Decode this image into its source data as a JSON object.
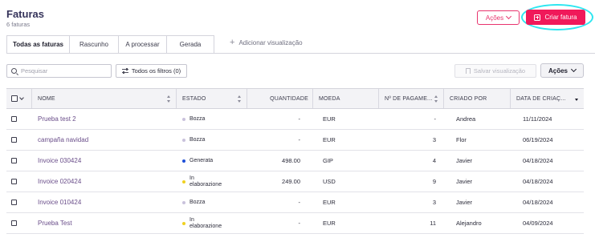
{
  "header": {
    "title": "Faturas",
    "subtitle": "6 faturas",
    "actions_label": "Ações",
    "create_label": "Criar fatura"
  },
  "tabs": [
    {
      "label": "Todas as faturas",
      "active": true
    },
    {
      "label": "Rascunho",
      "active": false
    },
    {
      "label": "A processar",
      "active": false
    },
    {
      "label": "Gerada",
      "active": false
    }
  ],
  "add_view_label": "Adicionar visualização",
  "toolbar": {
    "search_placeholder": "Pesquisar",
    "filters_label": "Todos os filtros (0)",
    "save_view_label": "Salvar visualização",
    "actions_label": "Ações"
  },
  "columns": [
    "NOME",
    "ESTADO",
    "QUANTIDADE",
    "MOEDA",
    "Nº DE PAGAME...",
    "CRIADO POR",
    "DATA DE CRIAÇ..."
  ],
  "status_colors": {
    "Bozza": "#c9c2dc",
    "Generata": "#1e4fd8",
    "In elaborazione": "#f0d020"
  },
  "rows": [
    {
      "name": "Prueba test 2",
      "status": "Bozza",
      "amount": "-",
      "currency": "EUR",
      "payments": "-",
      "created_by": "Andrea",
      "created_at": "11/11/2024"
    },
    {
      "name": "campaña navidad",
      "status": "Bozza",
      "amount": "-",
      "currency": "EUR",
      "payments": "3",
      "created_by": "Flor",
      "created_at": "06/19/2024"
    },
    {
      "name": "Invoice 030424",
      "status": "Generata",
      "amount": "498.00",
      "currency": "GIP",
      "payments": "4",
      "created_by": "Javier",
      "created_at": "04/18/2024"
    },
    {
      "name": "Invoice 020424",
      "status": "In elaborazione",
      "amount": "249.00",
      "currency": "USD",
      "payments": "9",
      "created_by": "Javier",
      "created_at": "04/18/2024"
    },
    {
      "name": "Invoice 010424",
      "status": "Bozza",
      "amount": "-",
      "currency": "EUR",
      "payments": "3",
      "created_by": "Javier",
      "created_at": "04/18/2024"
    },
    {
      "name": "Prueba Test",
      "status": "In elaborazione",
      "amount": "-",
      "currency": "EUR",
      "payments": "11",
      "created_by": "Alejandro",
      "created_at": "04/09/2024"
    }
  ]
}
